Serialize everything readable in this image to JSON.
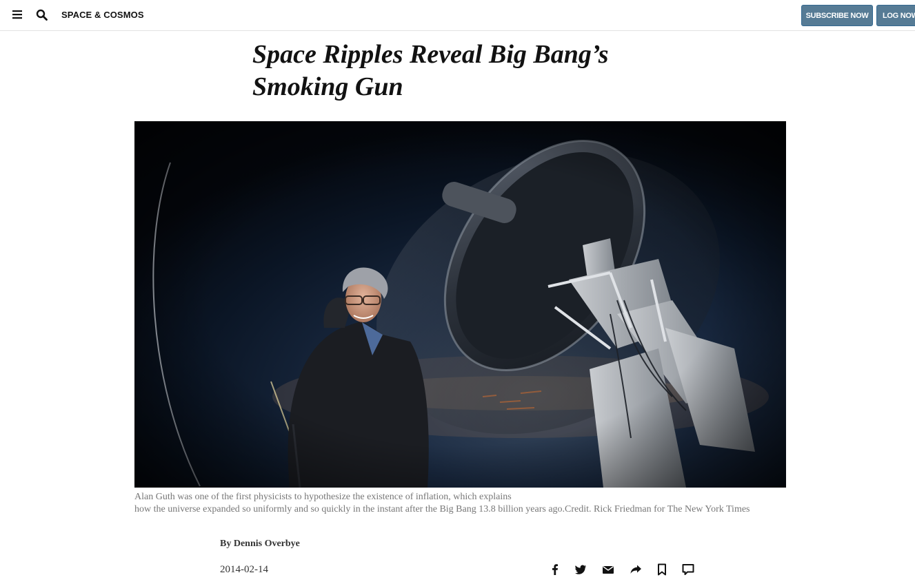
{
  "header": {
    "section": "SPACE & COSMOS",
    "subscribe_label": "SUBSCRIBE NOW",
    "login_label": "LOG NOW"
  },
  "article": {
    "headline_line1": "Space Ripples Reveal Big Bang’s",
    "headline_line2": "Smoking Gun",
    "caption_line1": "Alan Guth was one of the first physicists to hypothesize the existence of inflation, which explains",
    "caption_line2": "how the universe expanded so uniformly and so quickly in the instant after the Big Bang 13.8 billion years ago.Credit. Rick Friedman for The New York Times",
    "byline": "By Dennis Overbye",
    "date": "2014-02-14"
  },
  "share_icons": [
    "facebook-icon",
    "twitter-icon",
    "email-icon",
    "share-icon",
    "bookmark-icon",
    "comment-icon"
  ],
  "colors": {
    "button": "#567b95",
    "text": "#121212",
    "caption": "#777777"
  }
}
